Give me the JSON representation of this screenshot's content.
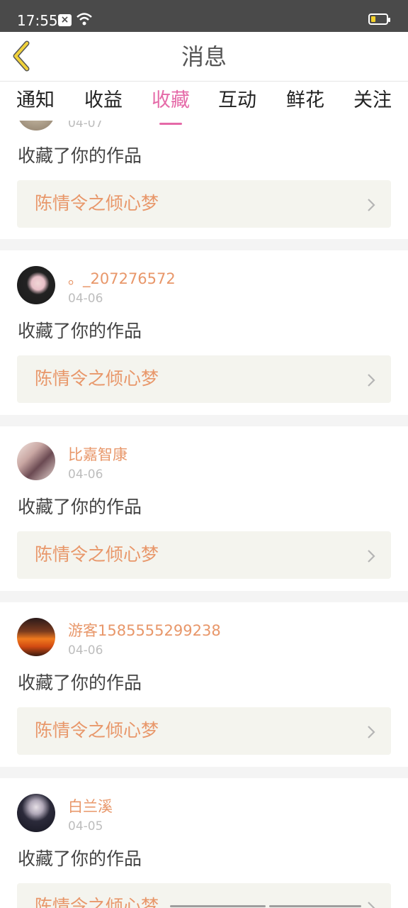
{
  "status_bar": {
    "time": "17:55",
    "sim_icon": "sim-x-icon",
    "wifi_icon": "wifi-icon",
    "battery_icon": "battery-low-icon",
    "battery_level": 0.2
  },
  "header": {
    "title": "消息",
    "back_icon": "chevron-left-icon",
    "back_color": "#f1d23a"
  },
  "tabs": [
    {
      "label": "通知",
      "active": false
    },
    {
      "label": "收益",
      "active": false
    },
    {
      "label": "收藏",
      "active": true
    },
    {
      "label": "互动",
      "active": false
    },
    {
      "label": "鲜花",
      "active": false
    },
    {
      "label": "关注",
      "active": false
    }
  ],
  "accent_color": "#e56aa8",
  "name_color": "#e8976a",
  "messages": [
    {
      "user": "",
      "date": "04-07",
      "action": "收藏了你的作品",
      "work": "陈情令之倾心梦"
    },
    {
      "user": "。_207276572",
      "date": "04-06",
      "action": "收藏了你的作品",
      "work": "陈情令之倾心梦"
    },
    {
      "user": "比嘉智康",
      "date": "04-06",
      "action": "收藏了你的作品",
      "work": "陈情令之倾心梦"
    },
    {
      "user": "游客1585555299238",
      "date": "04-06",
      "action": "收藏了你的作品",
      "work": "陈情令之倾心梦"
    },
    {
      "user": "白兰溪",
      "date": "04-05",
      "action": "收藏了你的作品",
      "work": "陈情令之倾心梦"
    }
  ]
}
